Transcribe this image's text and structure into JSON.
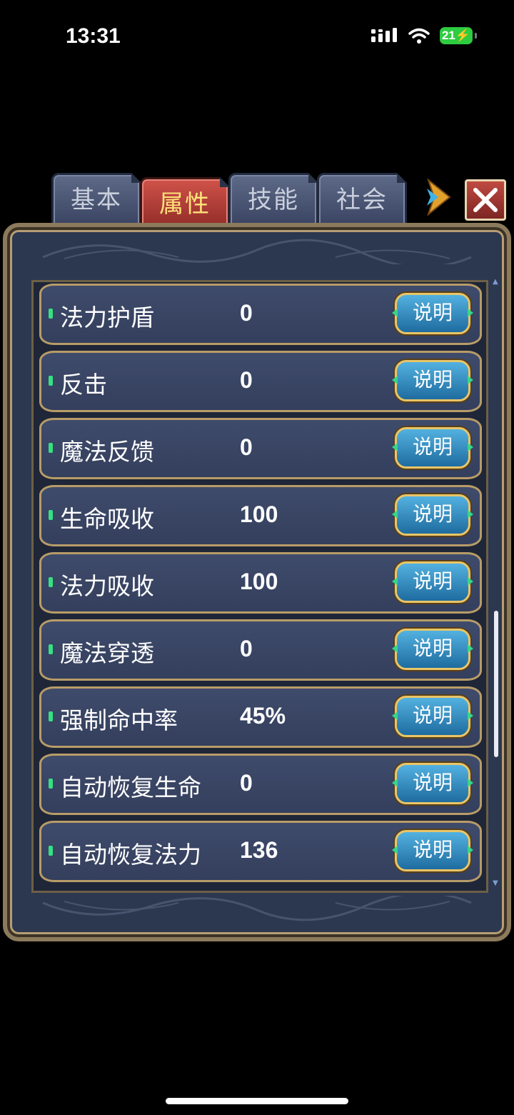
{
  "status": {
    "time": "13:31",
    "battery": "21"
  },
  "tabs": [
    {
      "label": "基本",
      "active": false
    },
    {
      "label": "属性",
      "active": true
    },
    {
      "label": "技能",
      "active": false
    },
    {
      "label": "社会",
      "active": false
    }
  ],
  "colors": {
    "active_tab": "#b8403a",
    "inactive_tab": "#4a5573",
    "panel": "#2c3750",
    "row_marker": "#35e081",
    "button": "#3a8cc4",
    "border_gold": "#b89c68"
  },
  "rows": [
    {
      "label": "法力护盾",
      "value": "0",
      "button": "说明"
    },
    {
      "label": "反击",
      "value": "0",
      "button": "说明"
    },
    {
      "label": "魔法反馈",
      "value": "0",
      "button": "说明"
    },
    {
      "label": "生命吸收",
      "value": "100",
      "button": "说明"
    },
    {
      "label": "法力吸收",
      "value": "100",
      "button": "说明"
    },
    {
      "label": "魔法穿透",
      "value": "0",
      "button": "说明"
    },
    {
      "label": "强制命中率",
      "value": "45%",
      "button": "说明"
    },
    {
      "label": "自动恢复生命",
      "value": "0",
      "button": "说明"
    },
    {
      "label": "自动恢复法力",
      "value": "136",
      "button": "说明"
    }
  ],
  "icons": {
    "arrow": "forward-arrow-icon",
    "close": "close-icon"
  }
}
